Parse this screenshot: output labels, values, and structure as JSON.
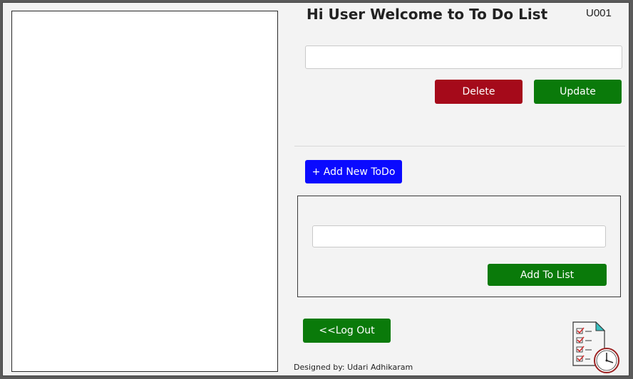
{
  "header": {
    "title": "Hi User Welcome to To Do List",
    "user_id": "U001"
  },
  "edit": {
    "input_value": "",
    "input_placeholder": "",
    "delete_label": "Delete",
    "update_label": "Update"
  },
  "add": {
    "add_new_label": "+ Add New ToDo",
    "input_value": "",
    "input_placeholder": "",
    "add_to_list_label": "Add To List"
  },
  "footer": {
    "logout_label": "<<Log Out",
    "credit": "Designed by: Udari Adhikaram"
  },
  "colors": {
    "delete": "#a50a1a",
    "green": "#0a7a0a",
    "blue": "#0a0aff"
  },
  "icons": {
    "app_logo": "checklist-clock-icon"
  }
}
